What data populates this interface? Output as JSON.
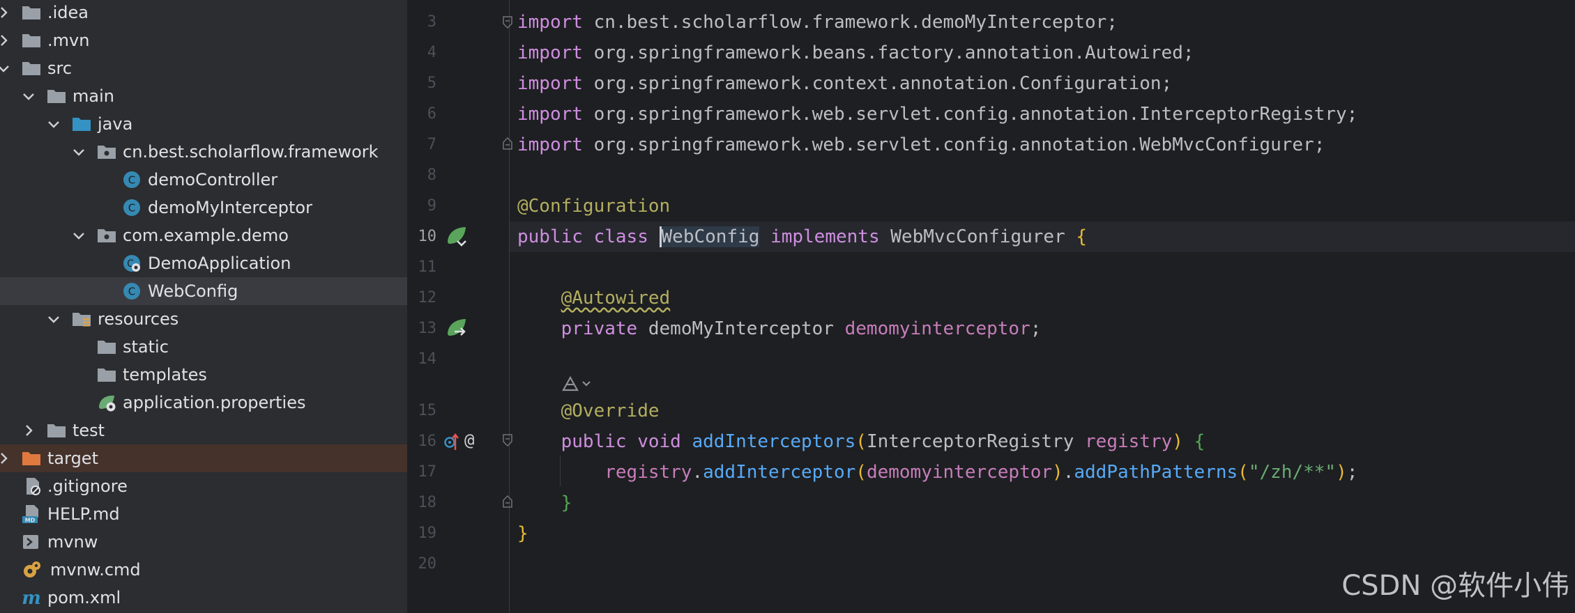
{
  "sidebar": {
    "items": [
      {
        "label": ".idea"
      },
      {
        "label": ".mvn"
      },
      {
        "label": "src"
      },
      {
        "label": "main"
      },
      {
        "label": "java"
      },
      {
        "label": "cn.best.scholarflow.framework"
      },
      {
        "label": "demoController"
      },
      {
        "label": "demoMyInterceptor"
      },
      {
        "label": "com.example.demo"
      },
      {
        "label": "DemoApplication"
      },
      {
        "label": "WebConfig"
      },
      {
        "label": "resources"
      },
      {
        "label": "static"
      },
      {
        "label": "templates"
      },
      {
        "label": "application.properties"
      },
      {
        "label": "test"
      },
      {
        "label": "target"
      },
      {
        "label": ".gitignore"
      },
      {
        "label": "HELP.md"
      },
      {
        "label": "mvnw"
      },
      {
        "label": "mvnw.cmd"
      },
      {
        "label": "pom.xml"
      }
    ]
  },
  "editor": {
    "line_numbers": [
      "3",
      "4",
      "5",
      "6",
      "7",
      "8",
      "9",
      "10",
      "11",
      "12",
      "13",
      "14",
      "15",
      "16",
      "17",
      "18",
      "19",
      "20"
    ],
    "lines": {
      "l3": {
        "kw": "import",
        "rest": " cn.best.scholarflow.framework.demoMyInterceptor;"
      },
      "l4": {
        "kw": "import",
        "rest": " org.springframework.beans.factory.annotation.Autowired;"
      },
      "l5": {
        "kw": "import",
        "rest": " org.springframework.context.annotation.Configuration;"
      },
      "l6": {
        "kw": "import",
        "rest": " org.springframework.web.servlet.config.annotation.InterceptorRegistry;"
      },
      "l7": {
        "kw": "import",
        "rest": " org.springframework.web.servlet.config.annotation.WebMvcConfigurer;"
      },
      "l9": {
        "ann": "@Configuration"
      },
      "l10": {
        "kw1": "public",
        "kw2": "class",
        "name": "WebConfig",
        "kw3": "implements",
        "iface": "WebMvcConfigurer",
        "brace": "{"
      },
      "l12": {
        "ann": "@Autowired"
      },
      "l13": {
        "kw": "private",
        "type": "demoMyInterceptor",
        "field": "demomyinterceptor",
        "semi": ";"
      },
      "l15": {
        "ann": "@Override"
      },
      "l16": {
        "kw1": "public",
        "kw2": "void",
        "meth": "addInterceptors",
        "p1": "(",
        "type": "InterceptorRegistry",
        "par": "registry",
        "p2": ")",
        "brace": "{"
      },
      "l17": {
        "obj": "registry",
        "dot1": ".",
        "meth1": "addInterceptor",
        "p1": "(",
        "field": "demomyinterceptor",
        "p2": ")",
        "dot2": ".",
        "meth2": "addPathPatterns",
        "p3": "(",
        "str": "\"/zh/**\"",
        "p4": ")",
        "semi": ";"
      },
      "l18": {
        "brace": "}"
      },
      "l19": {
        "brace": "}"
      }
    }
  },
  "watermark": "CSDN @软件小伟"
}
